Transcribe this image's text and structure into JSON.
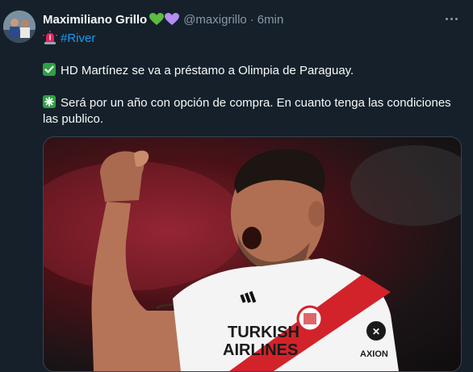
{
  "author": {
    "name": "Maximiliano Grillo",
    "handle": "@maxigrillo",
    "separator": "·",
    "time": "6min",
    "heart_colors": [
      "#5dbb3f",
      "#b48ef0"
    ]
  },
  "bio": {
    "tag": "#River"
  },
  "tweet": {
    "line1": "HD Martínez se va a préstamo a Olimpia de Paraguay.",
    "line2": "Será por un año con opción de compra. En cuanto tenga las condiciones las publico."
  },
  "media": {
    "shirt_text_1": "TURKISH",
    "shirt_text_2": "AIRLINES",
    "sponsor": "AXION"
  },
  "colors": {
    "link": "#1d9bf0",
    "check": "#2ea043"
  }
}
